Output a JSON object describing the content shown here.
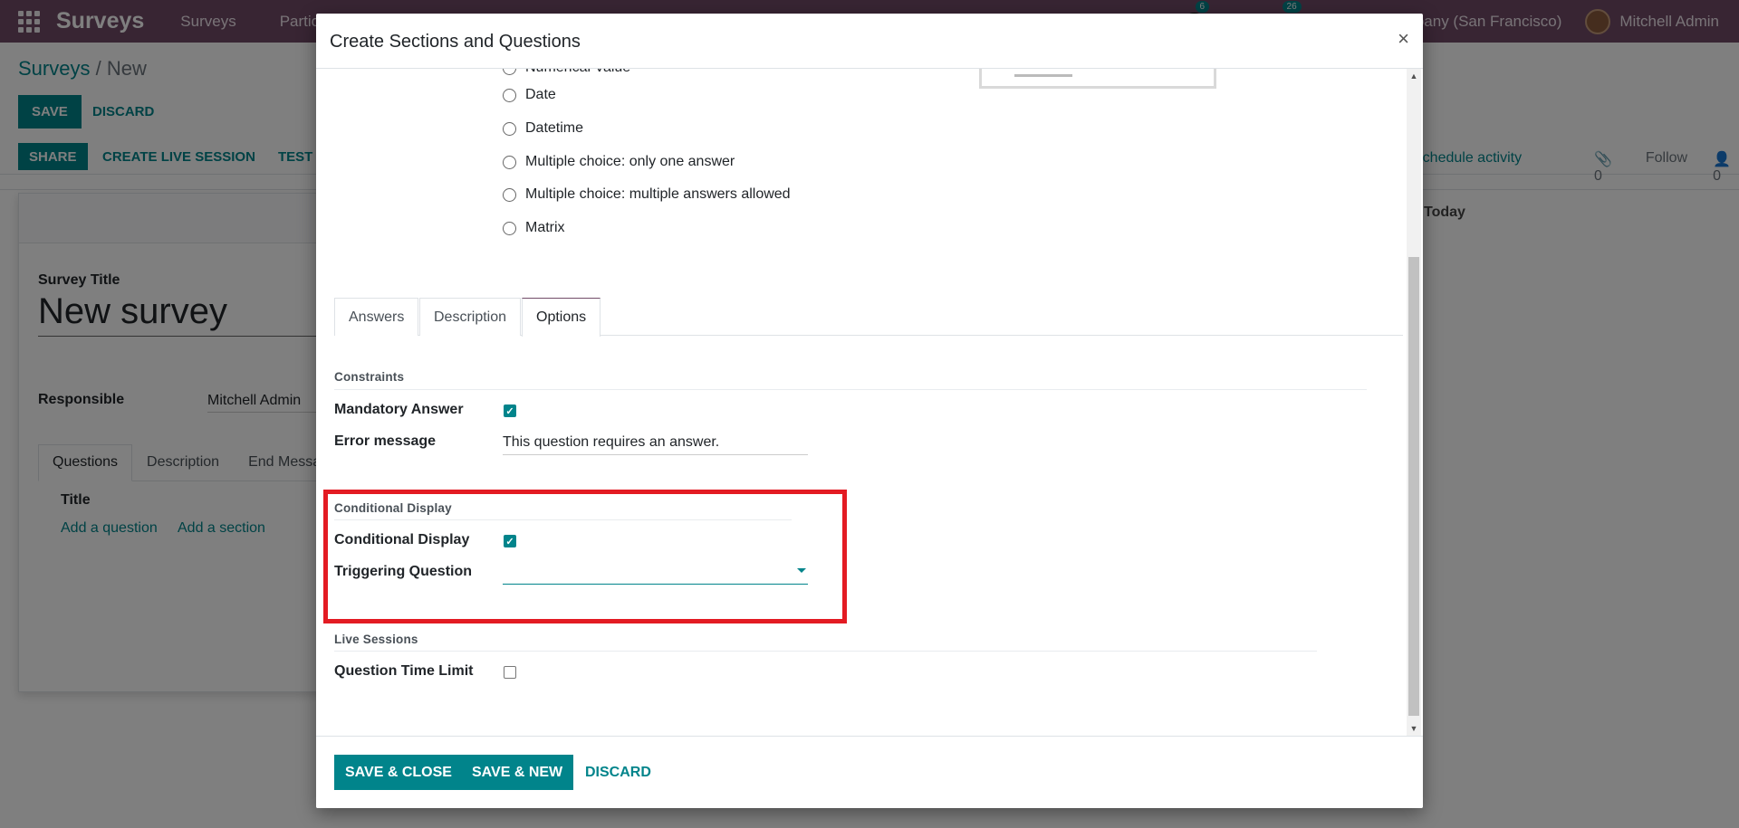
{
  "navbar": {
    "app_name": "Surveys",
    "menus": [
      "Surveys",
      "Participations"
    ],
    "chat_count": "6",
    "activity_count": "26",
    "company": "My Company (San Francisco)",
    "user": "Mitchell Admin"
  },
  "control": {
    "breadcrumb_parent": "Surveys",
    "breadcrumb_sep": "/",
    "breadcrumb_current": "New",
    "save_label": "SAVE",
    "discard_label": "DISCARD"
  },
  "statusbar": {
    "share_label": "SHARE",
    "live_session_label": "CREATE LIVE SESSION",
    "test_label": "TEST"
  },
  "form": {
    "title_label": "Survey Title",
    "title_value": "New survey",
    "responsible_label": "Responsible",
    "responsible_value": "Mitchell Admin",
    "tabs": [
      "Questions",
      "Description",
      "End Message"
    ],
    "column_title": "Title",
    "add_question": "Add a question",
    "add_section": "Add a section"
  },
  "chatter": {
    "schedule_activity": "Schedule activity",
    "attachments": "0",
    "follow": "Follow",
    "followers": "0",
    "today": "Today"
  },
  "modal": {
    "title": "Create Sections and Questions",
    "close": "×",
    "question_types": [
      "Numerical Value",
      "Date",
      "Datetime",
      "Multiple choice: only one answer",
      "Multiple choice: multiple answers allowed",
      "Matrix"
    ],
    "tabs": [
      "Answers",
      "Description",
      "Options"
    ],
    "active_tab": "Options",
    "constraints": {
      "group_title": "Constraints",
      "mandatory_label": "Mandatory Answer",
      "mandatory_checked": true,
      "error_label": "Error message",
      "error_value": "This question requires an answer."
    },
    "conditional": {
      "group_title": "Conditional Display",
      "cond_label": "Conditional Display",
      "cond_checked": true,
      "trigger_label": "Triggering Question",
      "trigger_value": ""
    },
    "live": {
      "group_title": "Live Sessions",
      "time_limit_label": "Question Time Limit",
      "time_limit_checked": false
    },
    "footer": {
      "save_close": "SAVE & CLOSE",
      "save_new": "SAVE & NEW",
      "discard": "DISCARD"
    }
  },
  "colors": {
    "brand": "#714b67",
    "accent": "#01848b",
    "highlight": "#e31b23"
  }
}
